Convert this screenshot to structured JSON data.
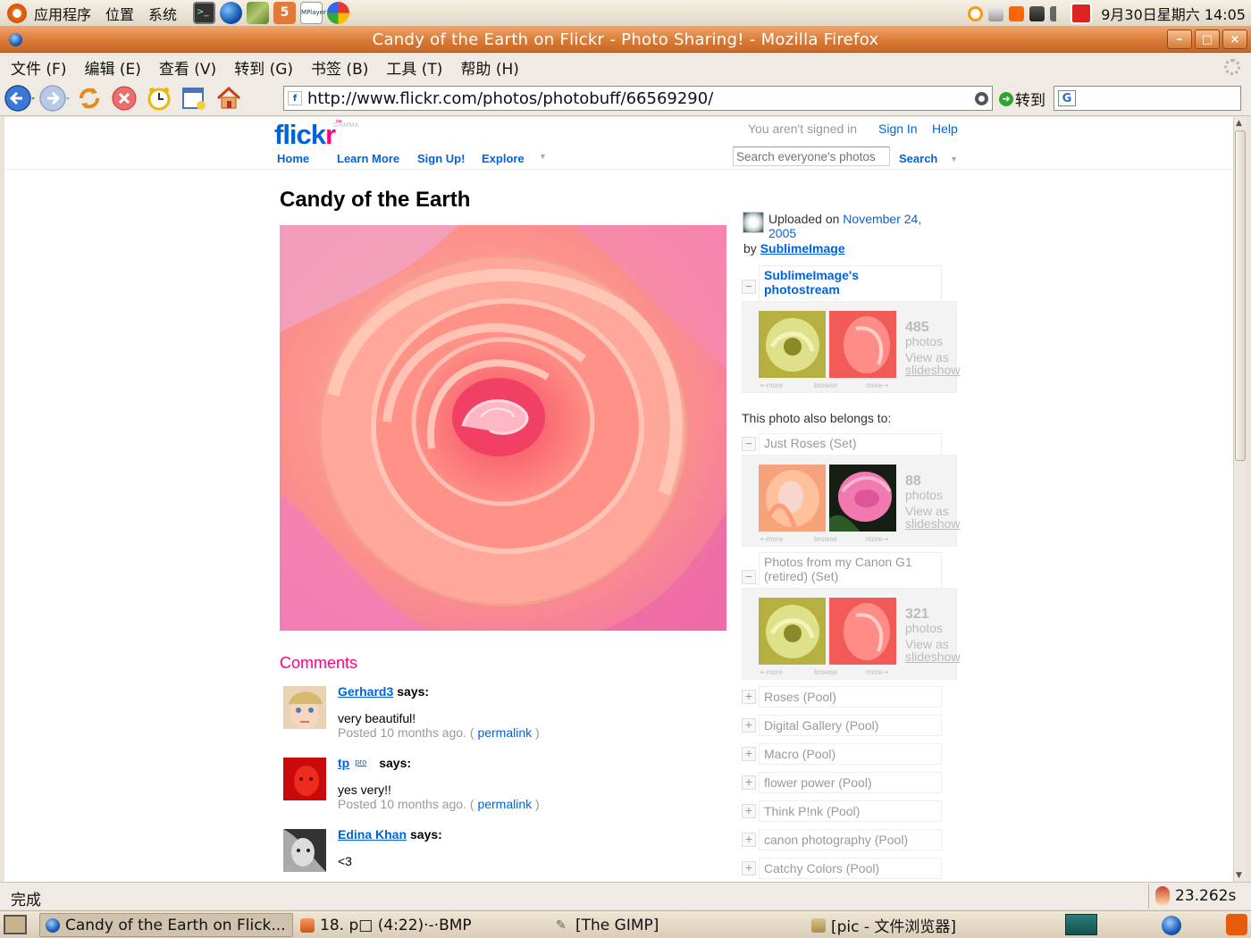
{
  "panel": {
    "menus": [
      "应用程序",
      "位置",
      "系统"
    ],
    "launchers": [
      "terminal-icon",
      "browser-icon",
      "books-icon",
      "html5-icon",
      "mplayer-icon",
      "picasa-icon"
    ],
    "mplayer_label": "MPlayer",
    "clock": "9月30日星期六 14:05"
  },
  "window": {
    "title": "Candy of the Earth on Flickr - Photo Sharing! - Mozilla Firefox",
    "minimize": "–",
    "maximize": "□",
    "close": "×"
  },
  "menubar": [
    "文件 (F)",
    "编辑 (E)",
    "查看 (V)",
    "转到 (G)",
    "书签 (B)",
    "工具 (T)",
    "帮助 (H)"
  ],
  "navbar": {
    "url": "http://www.flickr.com/photos/photobuff/66569290/",
    "favicon": "f",
    "go_label": "转到",
    "search_engine": "G"
  },
  "flickr": {
    "logo_a": "flick",
    "logo_b": "r",
    "logo_tm": "™",
    "gamma": "GAMMA",
    "signed_in": "You aren't signed in",
    "sign_in": "Sign In",
    "help": "Help",
    "nav": [
      "Home",
      "Learn More",
      "Sign Up!",
      "Explore"
    ],
    "search_placeholder": "Search everyone's photos",
    "search_button": "Search"
  },
  "photo": {
    "title": "Candy of the Earth",
    "uploaded_prefix": "Uploaded on",
    "uploaded_date": "November 24, 2005",
    "by_prefix": "by",
    "owner": "SublimeImage"
  },
  "comments": {
    "heading": "Comments",
    "says": "says:",
    "posted_prefix": "Posted 10 months ago. (",
    "permalink": "permalink",
    "posted_suffix": ")",
    "items": [
      {
        "user": "Gerhard3",
        "pro": "",
        "text": "very beautiful!",
        "show_meta": true
      },
      {
        "user": "tp",
        "pro": "pro",
        "text": "yes very!!",
        "show_meta": true
      },
      {
        "user": "Edina Khan",
        "pro": "",
        "text": "<3",
        "show_meta": false
      }
    ]
  },
  "sidebar": {
    "belongs": "This photo also belongs to:",
    "view_as": "View as",
    "slideshow": "slideshow",
    "photos_label": "photos",
    "more_l": "⇠more",
    "browse": "browse",
    "more_r": "more⇢",
    "photostream": {
      "title": "SublimeImage's photostream",
      "count": "485"
    },
    "sets": [
      {
        "title": "Just Roses (Set)",
        "count": "88"
      },
      {
        "title": "Photos from my Canon G1 (retired) (Set)",
        "count": "321"
      }
    ],
    "pools": [
      "Roses (Pool)",
      "Digital Gallery (Pool)",
      "Macro (Pool)",
      "flower power (Pool)",
      "Think P!nk (Pool)",
      "canon photography (Pool)",
      "Catchy Colors (Pool)"
    ],
    "minus": "−",
    "plus": "+"
  },
  "status": {
    "text": "完成",
    "timer": "23.262s"
  },
  "taskbar": [
    {
      "label": "Candy of the Earth on Flick...",
      "icon": "firefox-icon",
      "active": true
    },
    {
      "label": "18. p□ (4:22)·-·BMP",
      "icon": "image-viewer-icon",
      "active": false
    },
    {
      "label": "[The GIMP]",
      "icon": "gimp-icon",
      "active": false
    },
    {
      "label": "[pic - 文件浏览器]",
      "icon": "folder-icon",
      "active": false
    }
  ],
  "colors": {
    "flickr_blue": "#0063dc",
    "flickr_pink": "#ff0084",
    "title_orange": "#d97a35"
  }
}
